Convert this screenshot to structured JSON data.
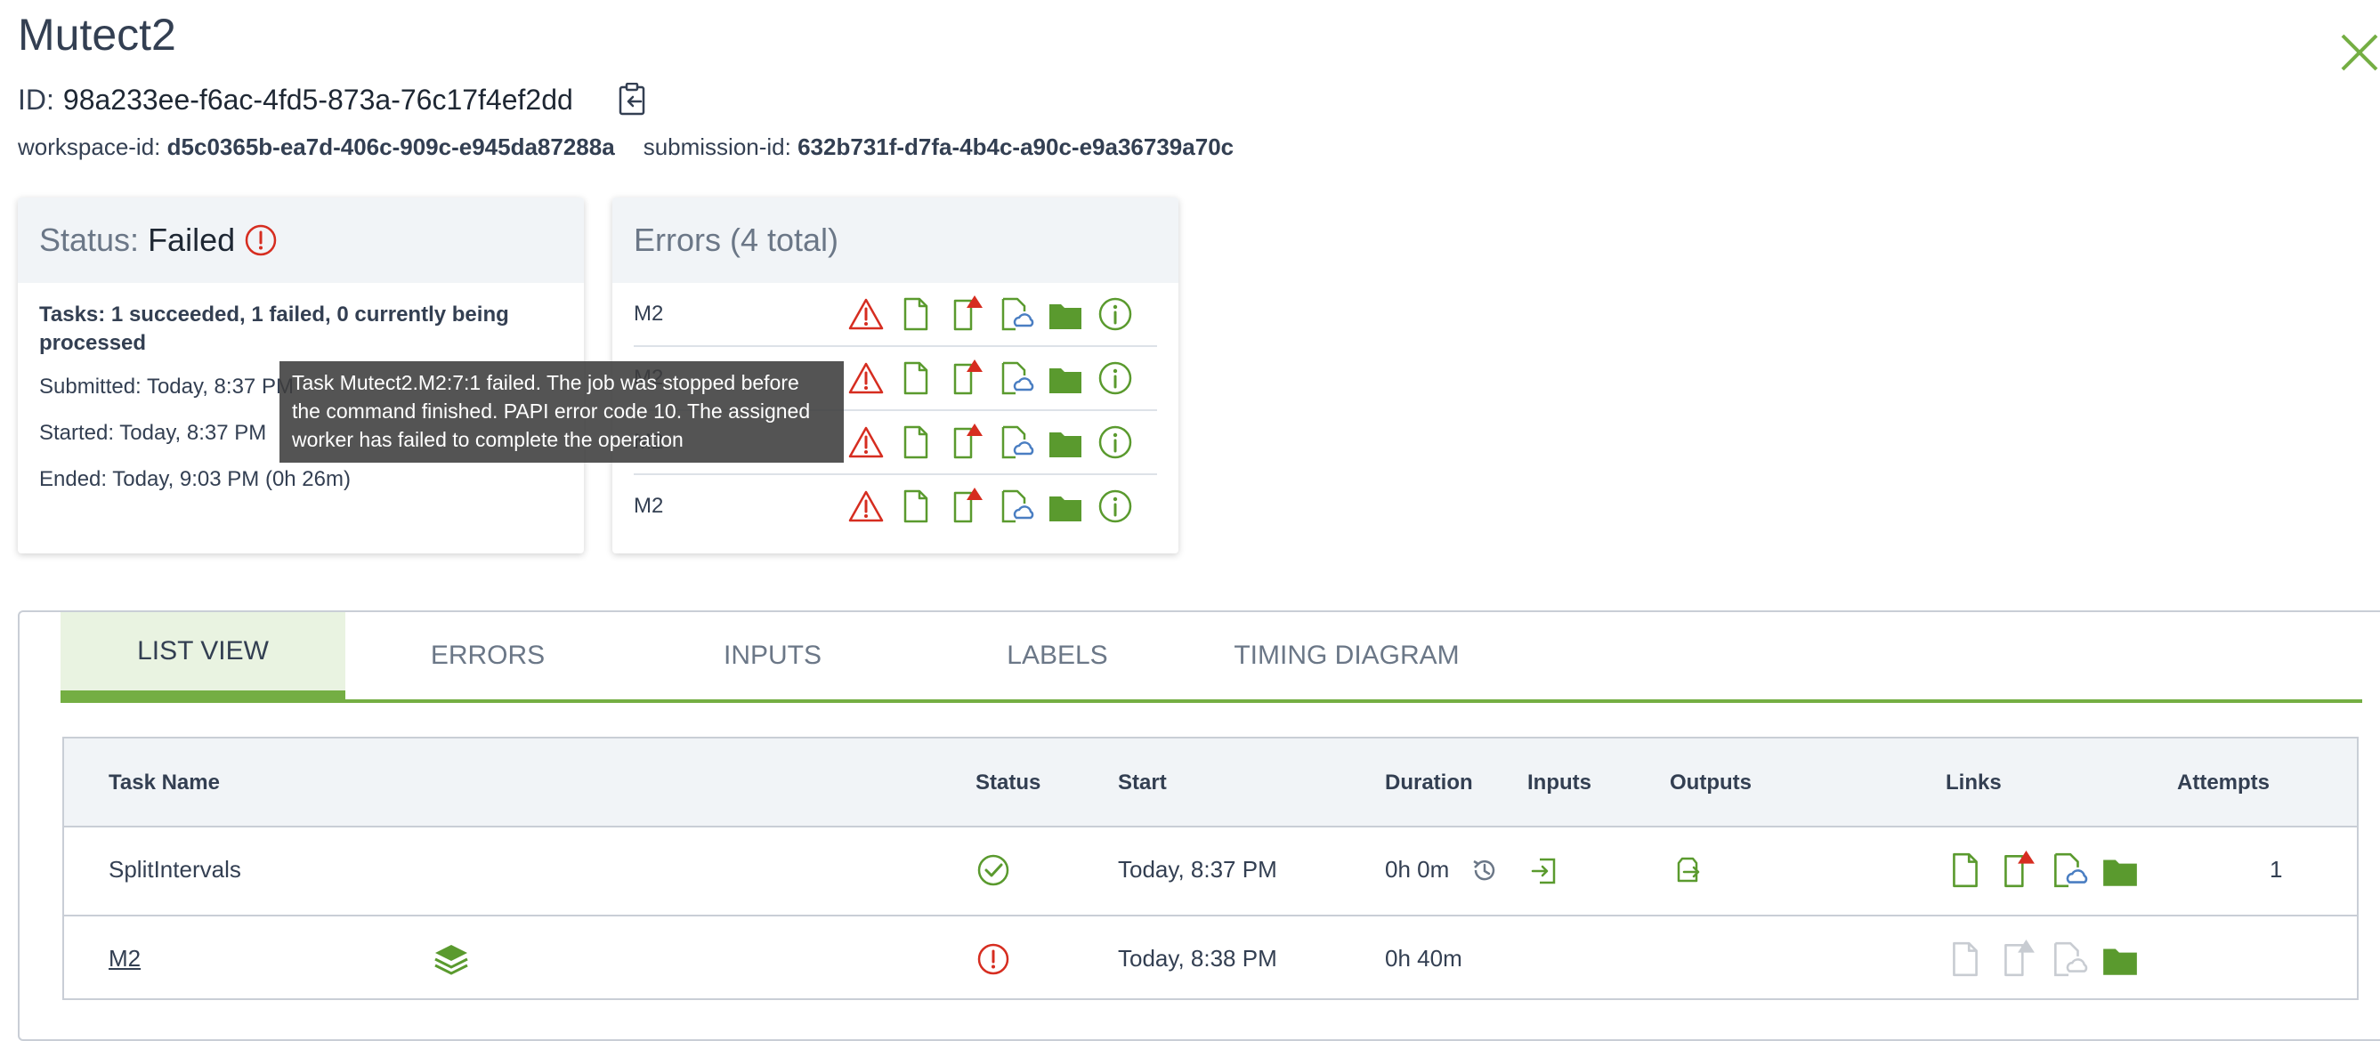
{
  "header": {
    "title": "Mutect2",
    "id_label": "ID:",
    "id_value": "98a233ee-f6ac-4fd5-873a-76c17f4ef2dd",
    "workspace_label": "workspace-id:",
    "workspace_value": "d5c0365b-ea7d-406c-909c-e945da87288a",
    "submission_label": "submission-id:",
    "submission_value": "632b731f-d7fa-4b4c-a90c-e9a36739a70c"
  },
  "status_card": {
    "label": "Status:",
    "value": "Failed",
    "tasks_summary": "Tasks: 1 succeeded, 1 failed, 0 currently being processed",
    "submitted": "Submitted: Today, 8:37 PM",
    "started": "Started: Today, 8:37 PM",
    "ended": "Ended: Today, 9:03 PM (0h 26m)"
  },
  "errors_card": {
    "title": "Errors (4 total)",
    "rows": [
      {
        "name": "M2"
      },
      {
        "name": "M2"
      },
      {
        "name": "M2"
      },
      {
        "name": "M2"
      }
    ]
  },
  "tooltip": {
    "text": "Task Mutect2.M2:7:1 failed. The job was stopped before the command finished. PAPI error code 10. The assigned worker has failed to complete the operation"
  },
  "tabs": [
    {
      "label": "LIST VIEW",
      "active": true
    },
    {
      "label": "ERRORS",
      "active": false
    },
    {
      "label": "INPUTS",
      "active": false
    },
    {
      "label": "LABELS",
      "active": false
    },
    {
      "label": "TIMING DIAGRAM",
      "active": false
    }
  ],
  "table": {
    "headers": {
      "task_name": "Task Name",
      "status": "Status",
      "start": "Start",
      "duration": "Duration",
      "inputs": "Inputs",
      "outputs": "Outputs",
      "links": "Links",
      "attempts": "Attempts"
    },
    "rows": [
      {
        "task_name": "SplitIntervals",
        "status": "succeeded",
        "start": "Today, 8:37 PM",
        "duration": "0h 0m",
        "attempts": "1"
      },
      {
        "task_name": "M2",
        "status": "failed",
        "start": "Today, 8:38 PM",
        "duration": "0h 40m",
        "attempts": ""
      }
    ]
  },
  "colors": {
    "accent": "#74ae43",
    "icon_green": "#5a9a2e",
    "error_red": "#d62d20",
    "cloud_blue": "#4a7ec2",
    "muted_icon": "#c8ccd2"
  },
  "icons": {
    "close": "close-icon",
    "copy": "copy-to-clipboard-icon",
    "status_failed": "error-circle-icon",
    "warning": "warning-triangle-icon",
    "log_file": "log-file-icon",
    "stderr_file": "stderr-file-icon",
    "cloud_file": "cloud-file-icon",
    "folder": "folder-icon",
    "info": "info-circle-icon",
    "success": "check-circle-icon",
    "history": "history-icon",
    "inputs": "inputs-icon",
    "outputs": "outputs-icon",
    "scatter": "layers-icon"
  }
}
